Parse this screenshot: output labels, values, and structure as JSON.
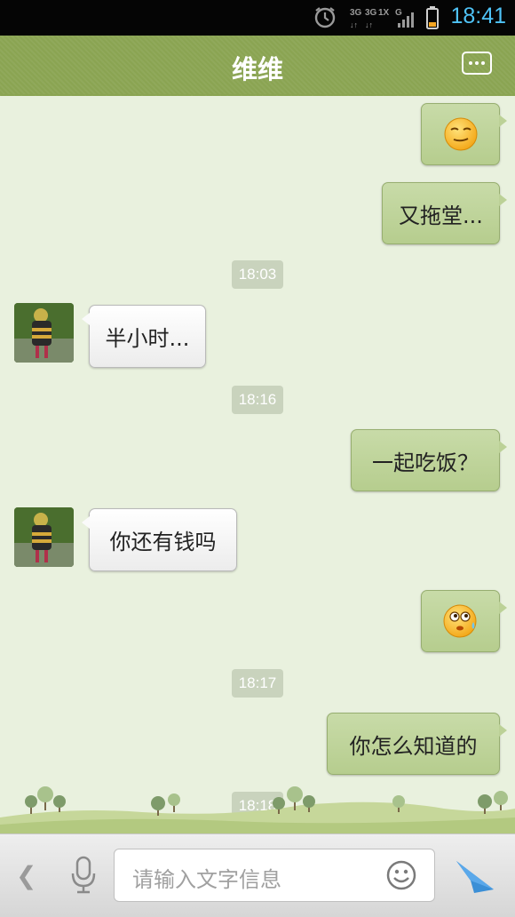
{
  "status_bar": {
    "time": "18:41",
    "network_labels": [
      "3G",
      "3G",
      "1X",
      "G"
    ],
    "icons": [
      "alarm-clock-icon",
      "signal-icon",
      "battery-icon"
    ]
  },
  "header": {
    "title": "维维",
    "menu_icon": "more-dots-icon"
  },
  "messages": [
    {
      "side": "out",
      "type": "emoji",
      "icon": "smirk-emoji-icon"
    },
    {
      "side": "out",
      "type": "text",
      "text": "又拖堂..."
    },
    {
      "side": "center",
      "type": "time",
      "text": "18:03"
    },
    {
      "side": "in",
      "type": "text",
      "text": "半小时..."
    },
    {
      "side": "center",
      "type": "time",
      "text": "18:16"
    },
    {
      "side": "out",
      "type": "text",
      "text": "一起吃饭？"
    },
    {
      "side": "in",
      "type": "text",
      "text": "你还有钱吗"
    },
    {
      "side": "out",
      "type": "emoji",
      "icon": "sweating-emoji-icon"
    },
    {
      "side": "center",
      "type": "time",
      "text": "18:17"
    },
    {
      "side": "out",
      "type": "text",
      "text": "你怎么知道的"
    },
    {
      "side": "center",
      "type": "time",
      "text": "18:18"
    }
  ],
  "input_bar": {
    "back_icon": "chevron-left-icon",
    "voice_icon": "microphone-icon",
    "placeholder": "请输入文字信息",
    "emoji_icon": "smiley-icon",
    "send_icon": "send-icon"
  },
  "colors": {
    "header_green": "#8aa452",
    "outgoing_bubble": "#bfd49b",
    "incoming_bubble": "#f5f5f5",
    "chat_bg": "#e9f1de",
    "time_blue": "#4fc3f7"
  }
}
